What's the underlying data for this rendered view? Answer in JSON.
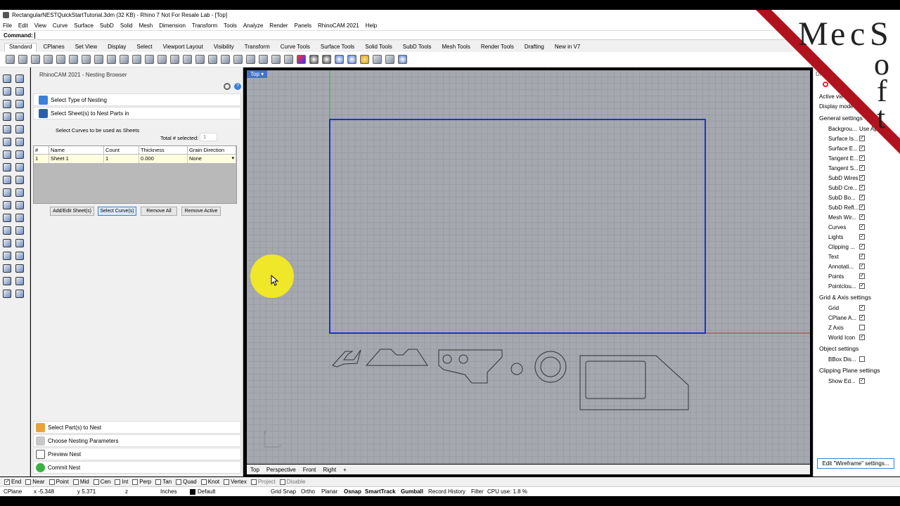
{
  "window": {
    "title": "RectangularNESTQuickStartTutorial.3dm (32 KB) - Rhino 7 Not For Resale Lab - [Top]"
  },
  "menu": [
    "File",
    "Edit",
    "View",
    "Curve",
    "Surface",
    "SubD",
    "Solid",
    "Mesh",
    "Dimension",
    "Transform",
    "Tools",
    "Analyze",
    "Render",
    "Panels",
    "RhinoCAM 2021",
    "Help"
  ],
  "command": {
    "label": "Command:"
  },
  "toolbar_tabs": [
    "Standard",
    "CPlanes",
    "Set View",
    "Display",
    "Select",
    "Viewport Layout",
    "Visibility",
    "Transform",
    "Curve Tools",
    "Surface Tools",
    "Solid Tools",
    "SubD Tools",
    "Mesh Tools",
    "Render Tools",
    "Drafting",
    "New in V7"
  ],
  "panel": {
    "title": "RhinoCAM 2021 - Nesting Browser",
    "steps_top": [
      "Select Type of Nesting",
      "Select Sheet(s) to Nest Parts in"
    ],
    "instruction": "Select Curves to be used as Sheets",
    "total_label": "Total # selected:",
    "total_value": "1",
    "table_headers": [
      "#",
      "Name",
      "Count",
      "Thickness",
      "Grain Direction"
    ],
    "table_rows": [
      [
        "1",
        "Sheet 1",
        "1",
        "0.000",
        "None"
      ]
    ],
    "buttons": [
      "Add/Edit Sheet(s)",
      "Select Curve(s)",
      "Remove All",
      "Remove Active"
    ],
    "steps_bottom": [
      "Select Part(s) to Nest",
      "Choose Nesting Parameters",
      "Preview Nest",
      "Commit Nest"
    ]
  },
  "viewport": {
    "name": "Top"
  },
  "viewport_tabs": [
    "Top",
    "Perspective",
    "Front",
    "Right"
  ],
  "display_panel": {
    "title": "Di",
    "active_view": "Active vie",
    "display_mode": "Display mode",
    "general_settings": "General settings",
    "background": "Backgrou...",
    "background_value": "Use Ap",
    "general_items": [
      "Surface Is...",
      "Surface E...",
      "Tangent E...",
      "Tangent S...",
      "SubD Wires",
      "SubD Cre...",
      "SubD Bo...",
      "SubD Refl...",
      "Mesh Wir...",
      "Curves",
      "Lights",
      "Clipping ...",
      "Text",
      "Annotati...",
      "Points",
      "Pointclou..."
    ],
    "grid_section": "Grid & Axis settings",
    "grid_items": [
      {
        "label": "Grid",
        "checked": true
      },
      {
        "label": "CPlane A...",
        "checked": true
      },
      {
        "label": "Z Axis",
        "checked": false
      },
      {
        "label": "World Icon",
        "checked": true
      }
    ],
    "object_section": "Object settings",
    "bbox": "BBox Dis...",
    "clipping_section": "Clipping Plane settings",
    "show_edges": "Show Ed...",
    "edit_button": "Edit \"Wireframe\" settings..."
  },
  "osnaps": [
    {
      "label": "End",
      "checked": true
    },
    {
      "label": "Near",
      "checked": false
    },
    {
      "label": "Point",
      "checked": false
    },
    {
      "label": "Mid",
      "checked": false
    },
    {
      "label": "Cen",
      "checked": false
    },
    {
      "label": "Int",
      "checked": false
    },
    {
      "label": "Perp",
      "checked": false
    },
    {
      "label": "Tan",
      "checked": false
    },
    {
      "label": "Quad",
      "checked": false
    },
    {
      "label": "Knot",
      "checked": false
    },
    {
      "label": "Vertex",
      "checked": false
    },
    {
      "label": "Project",
      "checked": false
    },
    {
      "label": "Disable",
      "checked": false
    }
  ],
  "status": {
    "cplane": "CPlane",
    "x": "x -5.348",
    "y": "y 5.371",
    "z": "z",
    "units": "Inches",
    "layer": "Default",
    "grid_snap": "Grid Snap",
    "ortho": "Ortho",
    "planar": "Planar",
    "osnap": "Osnap",
    "smarttrack": "SmartTrack",
    "gumball": "Gumball",
    "record_history": "Record History",
    "filter": "Filter",
    "cpu": "CPU use: 1.8 %"
  },
  "logo": {
    "letters": [
      "M",
      "e",
      "c",
      "S",
      "o",
      "f",
      "t"
    ]
  },
  "colors": {
    "accent": "#3c7fd6",
    "sheet_outline": "#1e2fd6",
    "logo_red": "#b0131d",
    "cursor_highlight": "#f4ec1e"
  }
}
